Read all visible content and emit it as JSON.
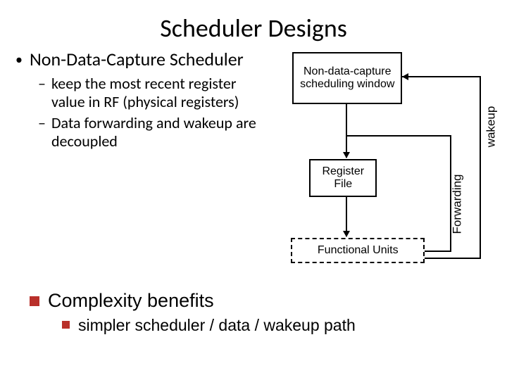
{
  "title": "Scheduler Designs",
  "bullets": {
    "main": "Non-Data-Capture Scheduler",
    "sub1": "keep the most recent register value in RF (physical registers)",
    "sub2": "Data forwarding and wakeup are decoupled"
  },
  "lower": {
    "title": "Complexity benefits",
    "sub": "simpler scheduler / data / wakeup path"
  },
  "diagram": {
    "sched_window": "Non-data-capture scheduling window",
    "register_file": "Register File",
    "functional_units": "Functional Units",
    "label_forwarding": "Forwarding",
    "label_wakeup": "wakeup"
  }
}
